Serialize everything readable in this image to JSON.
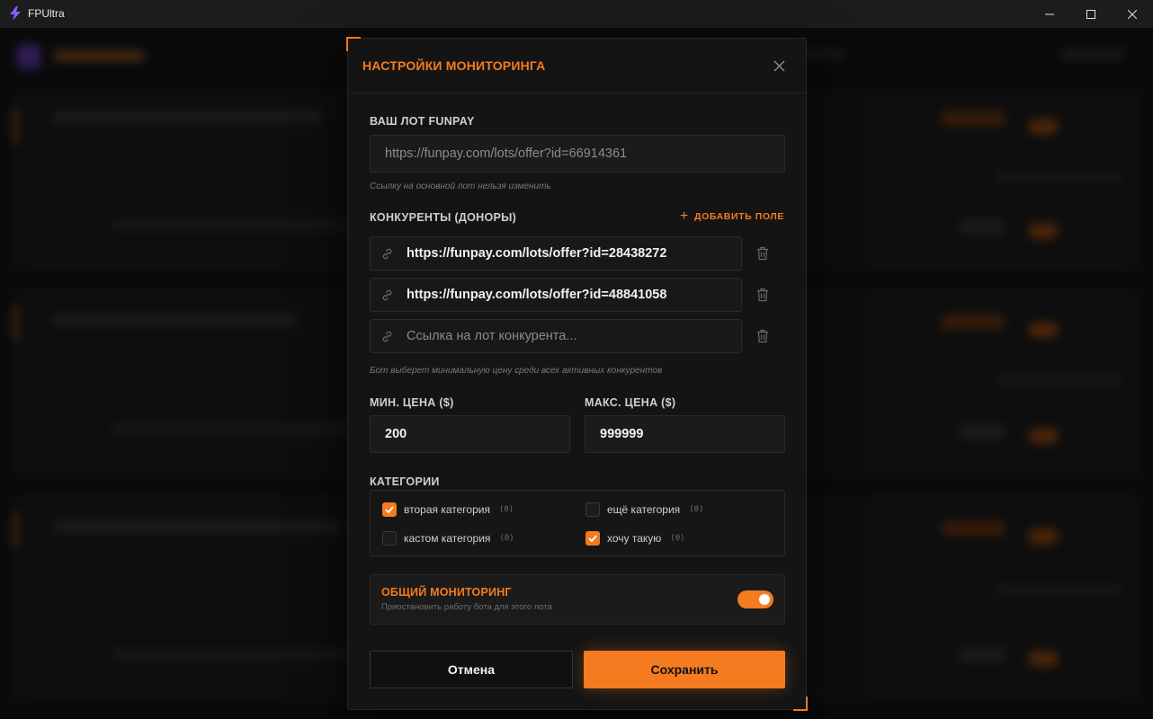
{
  "window": {
    "title": "FPUltra",
    "controls": [
      "minimize-icon",
      "maximize-icon",
      "close-icon"
    ]
  },
  "modal": {
    "title": "НАСТРОЙКИ МОНИТОРИНГА",
    "lot_section": {
      "label": "ВАШ ЛОТ FUNPAY",
      "value": "https://funpay.com/lots/offer?id=66914361",
      "hint": "Ссылку на основной лот нельзя изменить"
    },
    "competitors": {
      "label": "КОНКУРЕНТЫ (ДОНОРЫ)",
      "add_label": "ДОБАВИТЬ ПОЛЕ",
      "items": [
        {
          "value": "https://funpay.com/lots/offer?id=28438272",
          "placeholder": ""
        },
        {
          "value": "https://funpay.com/lots/offer?id=48841058",
          "placeholder": ""
        },
        {
          "value": "",
          "placeholder": "Ссылка на лот конкурента..."
        }
      ],
      "hint": "Бот выберет минимальную цену среди всех активных конкурентов"
    },
    "prices": {
      "min_label": "МИН. ЦЕНА ($)",
      "min_value": "200",
      "max_label": "МАКС. ЦЕНА ($)",
      "max_value": "999999"
    },
    "categories": {
      "label": "КАТЕГОРИИ",
      "items": [
        {
          "name": "вторая категория",
          "count": "(0)",
          "checked": true
        },
        {
          "name": "ещё категория",
          "count": "(0)",
          "checked": false
        },
        {
          "name": "кастом категория",
          "count": "(0)",
          "checked": false
        },
        {
          "name": "хочу такую",
          "count": "(0)",
          "checked": true
        }
      ]
    },
    "monitoring": {
      "title": "ОБЩИЙ МОНИТОРИНГ",
      "subtitle": "Приостановить работу бота для этого лота",
      "enabled": true
    },
    "buttons": {
      "cancel": "Отмена",
      "save": "Сохранить"
    }
  },
  "colors": {
    "accent": "#f47b20",
    "background": "#0b0b0b",
    "modal_bg": "#141414"
  }
}
